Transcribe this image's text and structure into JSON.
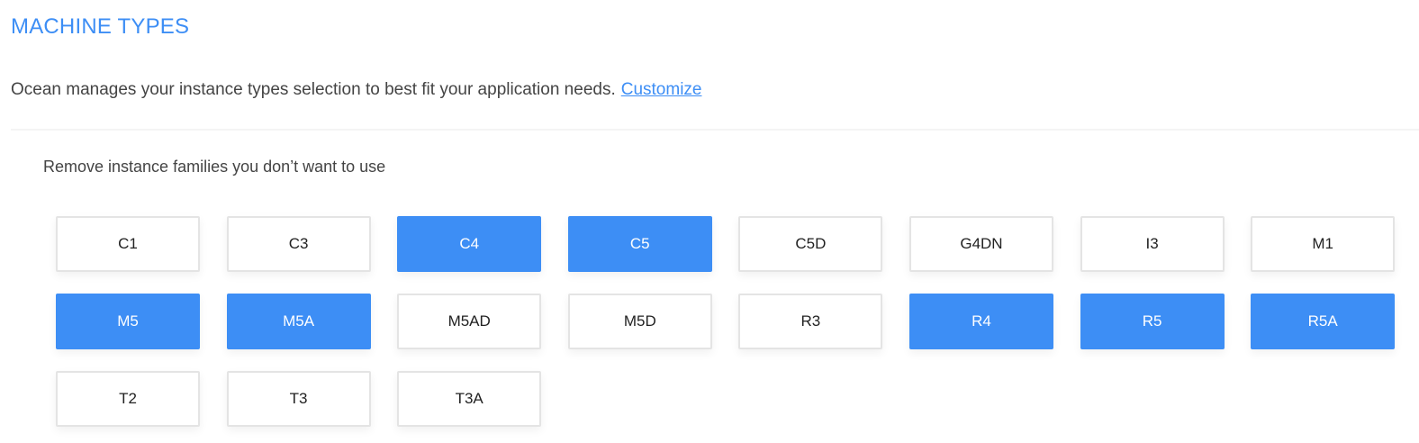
{
  "section_title": "MACHINE TYPES",
  "description": "Ocean manages your instance types selection to best fit your application needs.",
  "customize_link": "Customize",
  "subtitle": "Remove instance families you don’t want to use",
  "selected_color": "#3d8ef5",
  "families": [
    {
      "label": "C1",
      "selected": false
    },
    {
      "label": "C3",
      "selected": false
    },
    {
      "label": "C4",
      "selected": true
    },
    {
      "label": "C5",
      "selected": true
    },
    {
      "label": "C5D",
      "selected": false
    },
    {
      "label": "G4DN",
      "selected": false
    },
    {
      "label": "I3",
      "selected": false
    },
    {
      "label": "M1",
      "selected": false
    },
    {
      "label": "M5",
      "selected": true
    },
    {
      "label": "M5A",
      "selected": true
    },
    {
      "label": "M5AD",
      "selected": false
    },
    {
      "label": "M5D",
      "selected": false
    },
    {
      "label": "R3",
      "selected": false
    },
    {
      "label": "R4",
      "selected": true
    },
    {
      "label": "R5",
      "selected": true
    },
    {
      "label": "R5A",
      "selected": true
    },
    {
      "label": "T2",
      "selected": false
    },
    {
      "label": "T3",
      "selected": false
    },
    {
      "label": "T3A",
      "selected": false
    }
  ]
}
